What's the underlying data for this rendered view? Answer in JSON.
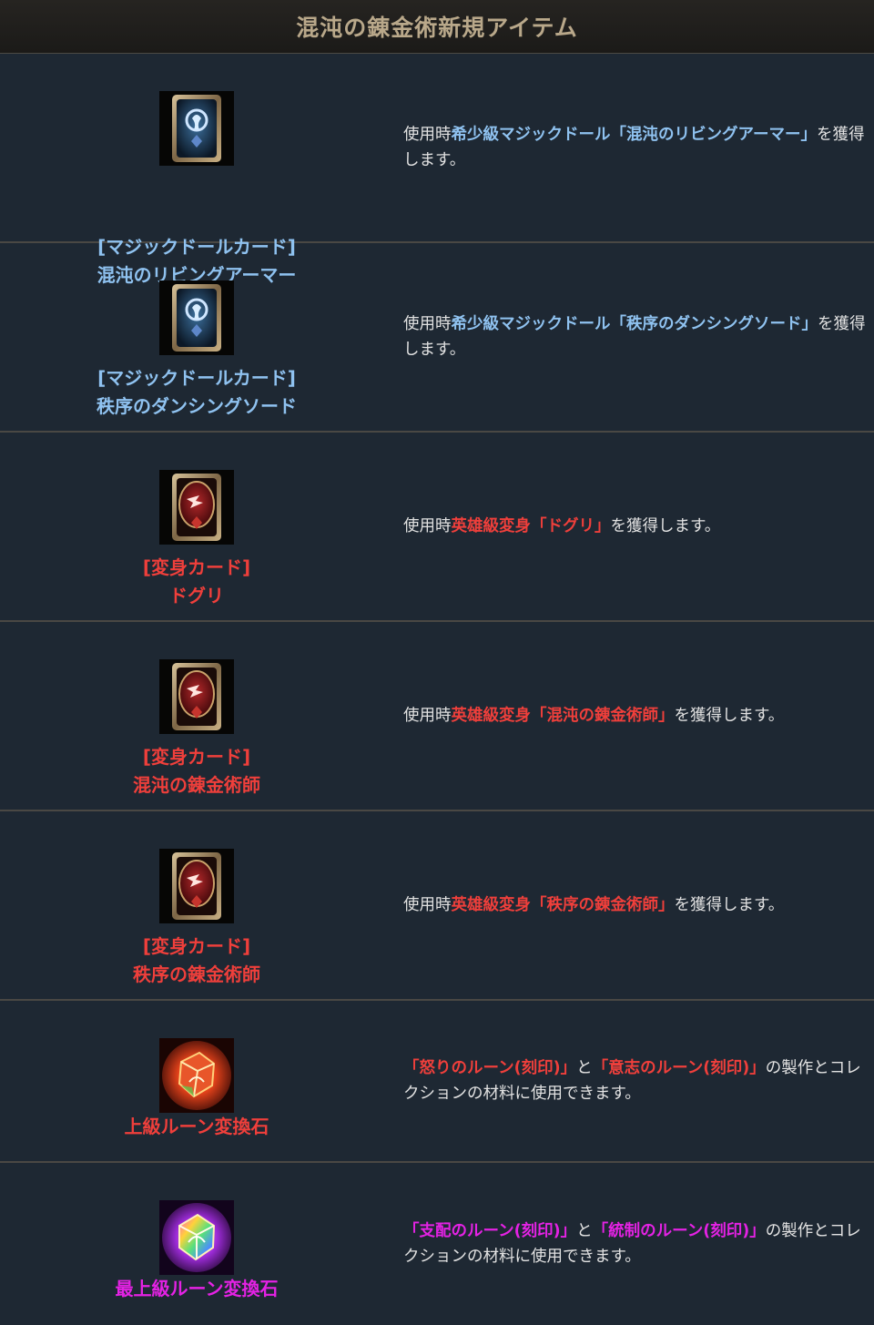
{
  "header": {
    "title": "混沌の錬金術新規アイテム"
  },
  "items": [
    {
      "name_line1": "[マジックドールカード]",
      "name_line2": "混沌のリビングアーマー",
      "desc_pre": "使用時",
      "desc_hl": "希少級マジックドール「混沌のリビングアーマー」",
      "desc_mid": "",
      "desc_hl2": "",
      "desc_post": "を獲得します。",
      "icon": "magic-doll-card-icon",
      "color": "#8fc2f0"
    },
    {
      "name_line1": "[マジックドールカード]",
      "name_line2": "秩序のダンシングソード",
      "desc_pre": "使用時",
      "desc_hl": "希少級マジックドール「秩序のダンシングソード」",
      "desc_mid": "",
      "desc_hl2": "",
      "desc_post": "を獲得します。",
      "icon": "magic-doll-card-icon",
      "color": "#8fc2f0"
    },
    {
      "name_line1": "[変身カード]",
      "name_line2": "ドグリ",
      "desc_pre": "使用時",
      "desc_hl": "英雄級変身「ドグリ」",
      "desc_mid": "",
      "desc_hl2": "",
      "desc_post": "を獲得します。",
      "icon": "transform-card-icon",
      "color": "#ef3f3b"
    },
    {
      "name_line1": "[変身カード]",
      "name_line2": "混沌の錬金術師",
      "desc_pre": "使用時",
      "desc_hl": "英雄級変身「混沌の錬金術師」",
      "desc_mid": "",
      "desc_hl2": "",
      "desc_post": "を獲得します。",
      "icon": "transform-card-icon",
      "color": "#ef3f3b"
    },
    {
      "name_line1": "[変身カード]",
      "name_line2": "秩序の錬金術師",
      "desc_pre": "使用時",
      "desc_hl": "英雄級変身「秩序の錬金術師」",
      "desc_mid": "",
      "desc_hl2": "",
      "desc_post": "を獲得します。",
      "icon": "transform-card-icon",
      "color": "#ef3f3b"
    },
    {
      "name_line1": "上級ルーン変換石",
      "name_line2": "",
      "desc_pre": "",
      "desc_hl": "「怒りのルーン(刻印)」",
      "desc_mid": "と",
      "desc_hl2": "「意志のルーン(刻印)」",
      "desc_post": "の製作とコレクションの材料に使用できます。",
      "icon": "rune-conversion-stone-icon",
      "color": "#ef3f3b"
    },
    {
      "name_line1": "最上級ルーン変換石",
      "name_line2": "",
      "desc_pre": "",
      "desc_hl": "「支配のルーン(刻印)」",
      "desc_mid": "と",
      "desc_hl2": "「統制のルーン(刻印)」",
      "desc_post": "の製作とコレクションの材料に使用できます。",
      "icon": "supreme-rune-conversion-stone-icon",
      "color": "#e422e4"
    }
  ]
}
